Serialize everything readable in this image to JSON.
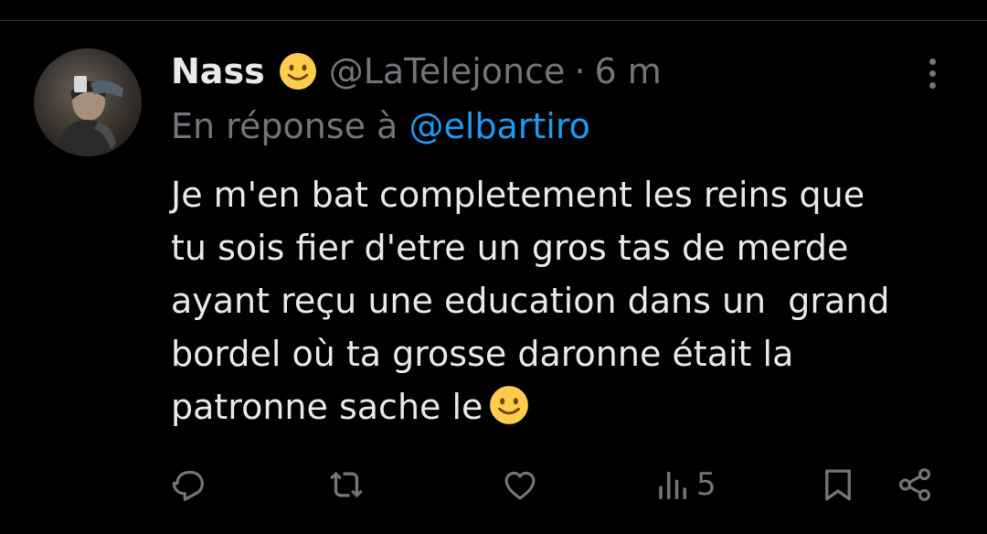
{
  "tweet": {
    "display_name": "Nass",
    "name_emoji": "slightly-smiling-face",
    "handle": "@LaTelejonce",
    "separator": "·",
    "time": "6 m",
    "reply_prefix": "En réponse à",
    "reply_to": "@elbartiro",
    "body_lines": [
      "Je m'en bat completement les reins que",
      "tu sois fier d'etre un gros tas de merde",
      "ayant reçu une education dans un  grand",
      "bordel où ta grosse daronne était la",
      "patronne sache le"
    ],
    "body_end_emoji": "slightly-smiling-face"
  },
  "actions": {
    "reply_icon": "reply-icon",
    "retweet_icon": "retweet-icon",
    "like_icon": "heart-icon",
    "views_icon": "views-icon",
    "views_count": "5",
    "bookmark_icon": "bookmark-icon",
    "share_icon": "share-icon"
  },
  "colors": {
    "background": "#000000",
    "text": "#e7e9ea",
    "secondary": "#71767b",
    "link": "#1d9bf0",
    "divider": "#2f3336",
    "emoji": "#ffcc4d"
  }
}
